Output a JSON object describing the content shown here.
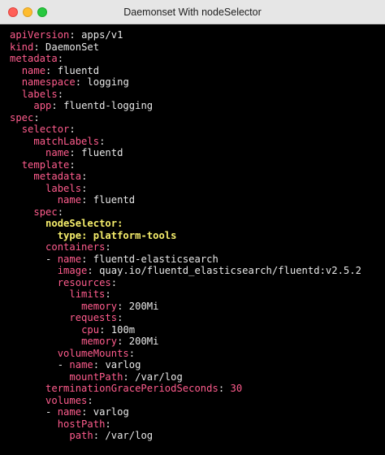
{
  "window": {
    "title": "Daemonset With nodeSelector"
  },
  "colors": {
    "key": "#ff5c8d",
    "highlight": "#f5ed6b",
    "text": "#e8e8e8",
    "background": "#000000"
  },
  "code_lines": [
    {
      "indent": "",
      "dash": "",
      "key": "apiVersion",
      "sep": ": ",
      "value": "apps/v1",
      "hl": false
    },
    {
      "indent": "",
      "dash": "",
      "key": "kind",
      "sep": ": ",
      "value": "DaemonSet",
      "hl": false
    },
    {
      "indent": "",
      "dash": "",
      "key": "metadata",
      "sep": ":",
      "value": "",
      "hl": false
    },
    {
      "indent": "  ",
      "dash": "",
      "key": "name",
      "sep": ": ",
      "value": "fluentd",
      "hl": false
    },
    {
      "indent": "  ",
      "dash": "",
      "key": "namespace",
      "sep": ": ",
      "value": "logging",
      "hl": false
    },
    {
      "indent": "  ",
      "dash": "",
      "key": "labels",
      "sep": ":",
      "value": "",
      "hl": false
    },
    {
      "indent": "    ",
      "dash": "",
      "key": "app",
      "sep": ": ",
      "value": "fluentd-logging",
      "hl": false
    },
    {
      "indent": "",
      "dash": "",
      "key": "spec",
      "sep": ":",
      "value": "",
      "hl": false
    },
    {
      "indent": "  ",
      "dash": "",
      "key": "selector",
      "sep": ":",
      "value": "",
      "hl": false
    },
    {
      "indent": "    ",
      "dash": "",
      "key": "matchLabels",
      "sep": ":",
      "value": "",
      "hl": false
    },
    {
      "indent": "      ",
      "dash": "",
      "key": "name",
      "sep": ": ",
      "value": "fluentd",
      "hl": false
    },
    {
      "indent": "  ",
      "dash": "",
      "key": "template",
      "sep": ":",
      "value": "",
      "hl": false
    },
    {
      "indent": "    ",
      "dash": "",
      "key": "metadata",
      "sep": ":",
      "value": "",
      "hl": false
    },
    {
      "indent": "      ",
      "dash": "",
      "key": "labels",
      "sep": ":",
      "value": "",
      "hl": false
    },
    {
      "indent": "        ",
      "dash": "",
      "key": "name",
      "sep": ": ",
      "value": "fluentd",
      "hl": false
    },
    {
      "indent": "    ",
      "dash": "",
      "key": "spec",
      "sep": ":",
      "value": "",
      "hl": false
    },
    {
      "indent": "      ",
      "dash": "",
      "key": "nodeSelector",
      "sep": ":",
      "value": "",
      "hl": true
    },
    {
      "indent": "        ",
      "dash": "",
      "key": "type",
      "sep": ": ",
      "value": "platform-tools",
      "hl": true
    },
    {
      "indent": "      ",
      "dash": "",
      "key": "containers",
      "sep": ":",
      "value": "",
      "hl": false
    },
    {
      "indent": "      ",
      "dash": "- ",
      "key": "name",
      "sep": ": ",
      "value": "fluentd-elasticsearch",
      "hl": false
    },
    {
      "indent": "        ",
      "dash": "",
      "key": "image",
      "sep": ": ",
      "value": "quay.io/fluentd_elasticsearch/fluentd:v2.5.2",
      "hl": false
    },
    {
      "indent": "        ",
      "dash": "",
      "key": "resources",
      "sep": ":",
      "value": "",
      "hl": false
    },
    {
      "indent": "          ",
      "dash": "",
      "key": "limits",
      "sep": ":",
      "value": "",
      "hl": false
    },
    {
      "indent": "            ",
      "dash": "",
      "key": "memory",
      "sep": ": ",
      "value": "200Mi",
      "hl": false
    },
    {
      "indent": "          ",
      "dash": "",
      "key": "requests",
      "sep": ":",
      "value": "",
      "hl": false
    },
    {
      "indent": "            ",
      "dash": "",
      "key": "cpu",
      "sep": ": ",
      "value": "100m",
      "hl": false
    },
    {
      "indent": "            ",
      "dash": "",
      "key": "memory",
      "sep": ": ",
      "value": "200Mi",
      "hl": false
    },
    {
      "indent": "        ",
      "dash": "",
      "key": "volumeMounts",
      "sep": ":",
      "value": "",
      "hl": false
    },
    {
      "indent": "        ",
      "dash": "- ",
      "key": "name",
      "sep": ": ",
      "value": "varlog",
      "hl": false
    },
    {
      "indent": "          ",
      "dash": "",
      "key": "mountPath",
      "sep": ": ",
      "value": "/var/log",
      "hl": false
    },
    {
      "indent": "      ",
      "dash": "",
      "key": "terminationGracePeriodSeconds",
      "sep": ": ",
      "value": "30",
      "hl": false,
      "numeric": true
    },
    {
      "indent": "      ",
      "dash": "",
      "key": "volumes",
      "sep": ":",
      "value": "",
      "hl": false
    },
    {
      "indent": "      ",
      "dash": "- ",
      "key": "name",
      "sep": ": ",
      "value": "varlog",
      "hl": false
    },
    {
      "indent": "        ",
      "dash": "",
      "key": "hostPath",
      "sep": ":",
      "value": "",
      "hl": false
    },
    {
      "indent": "          ",
      "dash": "",
      "key": "path",
      "sep": ": ",
      "value": "/var/log",
      "hl": false
    }
  ]
}
